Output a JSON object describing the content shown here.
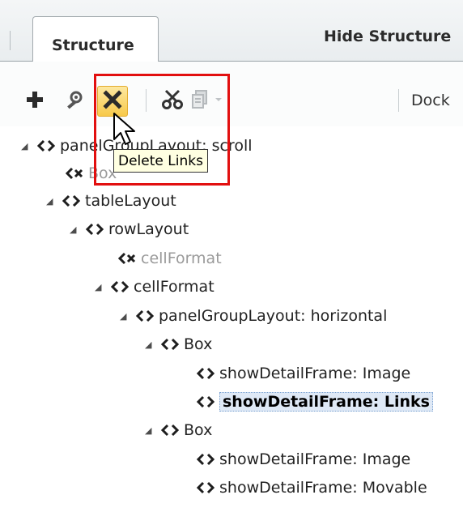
{
  "tabs": {
    "structure": "Structure",
    "hide_structure": "Hide Structure"
  },
  "toolbar": {
    "add_icon": "plus-icon",
    "properties_icon": "gear-wand-icon",
    "delete_icon": "delete-x-icon",
    "cut_icon": "scissors-icon",
    "copy_icon": "copy-icon",
    "dropdown_icon": "chevron-down-icon",
    "dock_label": "Dock"
  },
  "tooltip": "Delete Links",
  "tree": {
    "nodes": [
      {
        "label": "panelGroupLayout: scroll"
      },
      {
        "label": "Box"
      },
      {
        "label": "tableLayout"
      },
      {
        "label": "rowLayout"
      },
      {
        "label": "cellFormat"
      },
      {
        "label": "cellFormat"
      },
      {
        "label": "panelGroupLayout: horizontal"
      },
      {
        "label": "Box"
      },
      {
        "label": "showDetailFrame: Image"
      },
      {
        "label": "showDetailFrame: Links"
      },
      {
        "label": "Box"
      },
      {
        "label": "showDetailFrame: Image"
      },
      {
        "label": "showDetailFrame: Movable"
      }
    ]
  },
  "colors": {
    "highlight": "#e20f0f",
    "selection": "#dfe9f6",
    "tooltip_bg": "#ffffe1"
  }
}
